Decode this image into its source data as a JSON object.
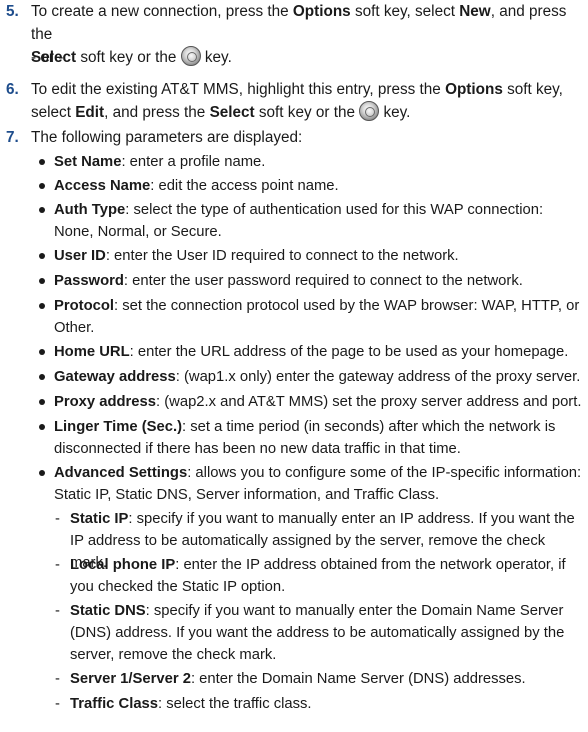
{
  "step5": {
    "num": "5.",
    "t1": "To create a new connection, press the ",
    "b1": "Options",
    "t2": " soft key, select ",
    "b2": "New",
    "t3": ", and press the ",
    "b3": "Select",
    "t4": " soft key or the ",
    "t5": " key."
  },
  "or_text": "- or -",
  "step6": {
    "num": "6.",
    "t1": "To edit the existing AT&T MMS, highlight this entry, press the ",
    "b1": "Options",
    "t2": " soft key, select ",
    "b2": "Edit",
    "t3": ", and press the ",
    "b3": "Select",
    "t4": " soft key or the ",
    "t5": " key."
  },
  "step7": {
    "num": "7.",
    "text": "The following parameters are displayed:"
  },
  "params": [
    {
      "term": "Set Name",
      "desc": ": enter a profile name."
    },
    {
      "term": "Access Name",
      "desc": ": edit the access point name."
    },
    {
      "term": "Auth Type",
      "desc": ": select the type of authentication used for this WAP connection: None, Normal, or Secure."
    },
    {
      "term": "User ID",
      "desc": ": enter the User ID required to connect to the network."
    },
    {
      "term": "Password",
      "desc": ": enter the user password required to connect to the network."
    },
    {
      "term": "Protocol",
      "desc": ": set the connection protocol used by the WAP browser: WAP, HTTP, or Other."
    },
    {
      "term": "Home URL",
      "desc": ": enter the URL address of the page to be used as your homepage."
    },
    {
      "term": "Gateway address",
      "desc": ": (wap1.x only) enter the gateway address of the proxy server."
    },
    {
      "term": "Proxy address",
      "desc": ": (wap2.x and AT&T MMS) set the proxy server address and port."
    },
    {
      "term": "Linger Time (Sec.)",
      "desc": ": set a time period (in seconds) after which the network is disconnected if there has been no new data traffic in that time."
    },
    {
      "term": "Advanced Settings",
      "desc": ": allows you to configure some of the IP-specific information: Static IP, Static DNS, Server information, and Traffic Class."
    }
  ],
  "advanced": [
    {
      "term": "Static IP",
      "desc": ": specify if you want to manually enter an IP address. If you want the IP address to be automatically assigned by the server, remove the check mark."
    },
    {
      "term": "Local phone IP",
      "desc": ": enter the IP address obtained from the network operator, if you checked the Static IP option."
    },
    {
      "term": "Static DNS",
      "desc": ": specify if you want to manually enter the Domain Name Server (DNS) address. If you want the address to be automatically assigned by the server, remove the check mark."
    },
    {
      "term": "Server 1/Server 2",
      "desc": ": enter the Domain Name Server (DNS) addresses."
    },
    {
      "term": "Traffic Class",
      "desc": ": select the traffic class."
    }
  ],
  "dash": "-",
  "icons": {
    "select_key": "select-key-icon"
  },
  "colors": {
    "step_number": "#1e4d8c"
  }
}
